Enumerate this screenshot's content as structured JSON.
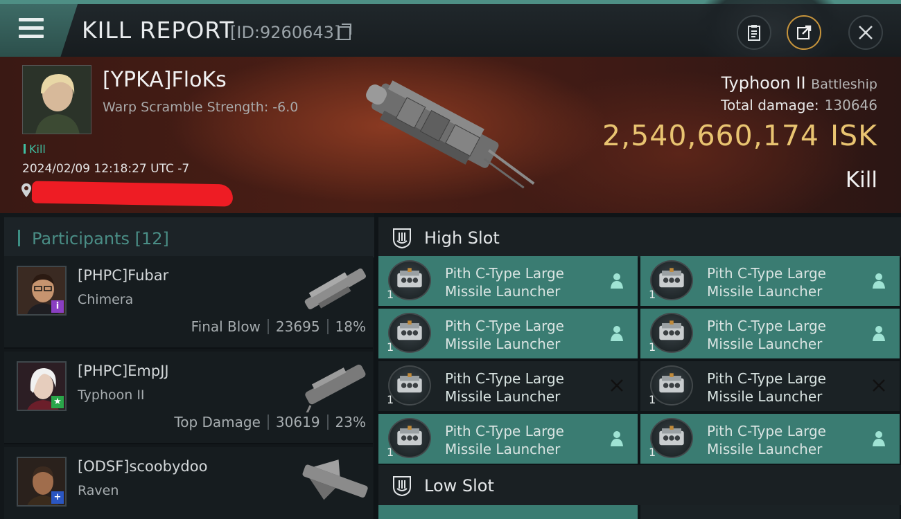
{
  "header": {
    "title": "KILL REPORT",
    "report_id": "[ID:9260643]"
  },
  "victim": {
    "name": "[YPKA]FloKs",
    "warp_scramble": "Warp Scramble Strength: -6.0",
    "tag": "Kill",
    "timestamp": "2024/02/09 12:18:27 UTC -7",
    "ship": "Typhoon II",
    "ship_class": "Battleship",
    "damage_label": "Total damage:",
    "damage_value": "130646",
    "isk_value": "2,540,660,174",
    "isk_unit": "ISK",
    "result": "Kill"
  },
  "participants": {
    "title": "Participants",
    "count": "[12]",
    "rows": [
      {
        "name": "[PHPC]Fubar",
        "ship": "Chimera",
        "role": "Final Blow",
        "damage": "23695",
        "percent": "18%",
        "badge": "i",
        "badge_color": "#8a3fc2"
      },
      {
        "name": "[PHPC]EmpJJ",
        "ship": "Typhoon II",
        "role": "Top Damage",
        "damage": "30619",
        "percent": "23%",
        "badge": "★",
        "badge_color": "#2aa64a"
      },
      {
        "name": "[ODSF]scoobydoo",
        "ship": "Raven",
        "role": "",
        "damage": "",
        "percent": "",
        "badge": "+",
        "badge_color": "#2a56c2"
      }
    ]
  },
  "slots": {
    "high_title": "High Slot",
    "low_title": "Low Slot",
    "modules": [
      {
        "name_l1": "Pith C-Type Large",
        "name_l2": "Missile Launcher",
        "qty": "1",
        "state": "dropped"
      },
      {
        "name_l1": "Pith C-Type Large",
        "name_l2": "Missile Launcher",
        "qty": "1",
        "state": "dropped"
      },
      {
        "name_l1": "Pith C-Type Large",
        "name_l2": "Missile Launcher",
        "qty": "1",
        "state": "dropped"
      },
      {
        "name_l1": "Pith C-Type Large",
        "name_l2": "Missile Launcher",
        "qty": "1",
        "state": "dropped"
      },
      {
        "name_l1": "Pith C-Type Large",
        "name_l2": "Missile Launcher",
        "qty": "1",
        "state": "destroyed"
      },
      {
        "name_l1": "Pith C-Type Large",
        "name_l2": "Missile Launcher",
        "qty": "1",
        "state": "destroyed"
      },
      {
        "name_l1": "Pith C-Type Large",
        "name_l2": "Missile Launcher",
        "qty": "1",
        "state": "dropped"
      },
      {
        "name_l1": "Pith C-Type Large",
        "name_l2": "Missile Launcher",
        "qty": "1",
        "state": "dropped"
      }
    ]
  },
  "icons": [
    "menu-icon",
    "copy-icon",
    "clipboard-icon",
    "share-icon",
    "close-icon",
    "location-pin-icon",
    "high-slot-icon",
    "low-slot-icon",
    "person-icon",
    "x-mark-icon",
    "missile-launcher-icon"
  ],
  "colors": {
    "accent": "#3a7c72",
    "isk": "#e9c471",
    "kill_tag": "#3fbfa1",
    "topbar_stripe": "#4e8f85"
  }
}
